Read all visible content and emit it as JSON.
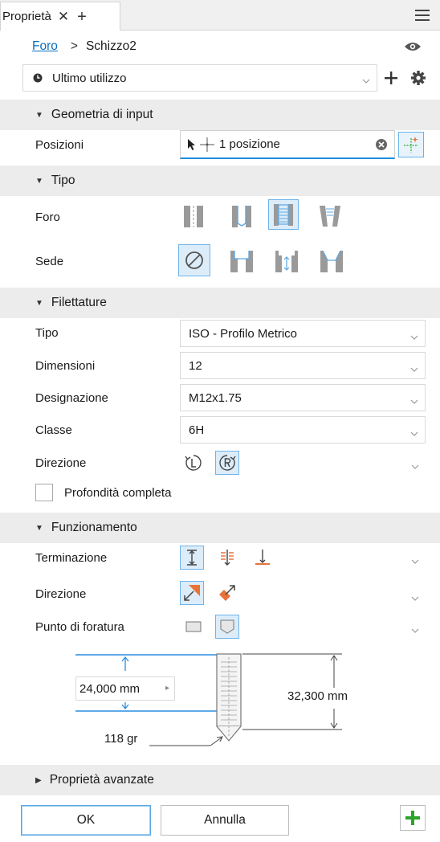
{
  "tab": {
    "label": "Proprietà",
    "close": "✕",
    "add": "+"
  },
  "breadcrumb": {
    "link": "Foro",
    "separator": ">",
    "current": "Schizzo2"
  },
  "preset": {
    "value": "Ultimo utilizzo"
  },
  "sections": {
    "input_geometry": "Geometria di input",
    "type": "Tipo",
    "threads": "Filettature",
    "behavior": "Funzionamento",
    "advanced": "Proprietà avanzate"
  },
  "input_geometry": {
    "positions_label": "Posizioni",
    "positions_value": "1 posizione"
  },
  "type": {
    "hole_label": "Foro",
    "seat_label": "Sede"
  },
  "threads": {
    "type_label": "Tipo",
    "type_value": "ISO - Profilo  Metrico",
    "size_label": "Dimensioni",
    "size_value": "12",
    "designation_label": "Designazione",
    "designation_value": "M12x1.75",
    "class_label": "Classe",
    "class_value": "6H",
    "direction_label": "Direzione",
    "full_depth_label": "Profondità completa",
    "full_depth_checked": false
  },
  "behavior": {
    "termination_label": "Terminazione",
    "direction_label": "Direzione",
    "drill_point_label": "Punto di foratura"
  },
  "diagram": {
    "depth": "24,000 mm",
    "thread_depth": "32,300 mm",
    "angle": "118 gr"
  },
  "footer": {
    "ok": "OK",
    "cancel": "Annulla"
  },
  "colors": {
    "accent": "#0a6fc2",
    "selected_bg": "#dcecf9",
    "selected_border": "#6fb4ea",
    "section_bg": "#ececec",
    "green": "#2aa52a",
    "orange": "#e8733a"
  }
}
